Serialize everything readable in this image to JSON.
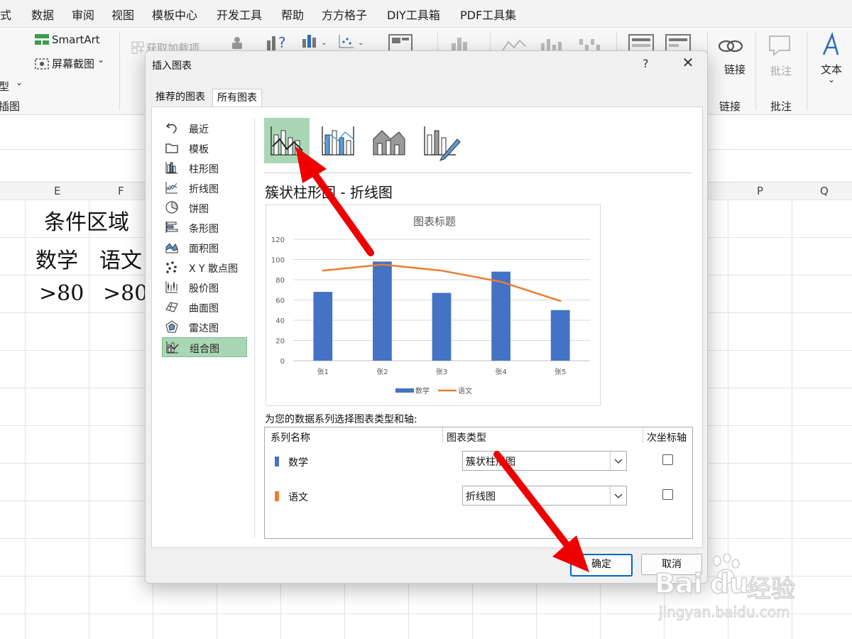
{
  "menu": {
    "items": [
      "公式",
      "数据",
      "审阅",
      "视图",
      "模板中心",
      "开发工具",
      "帮助",
      "方方格子",
      "DIY工具箱",
      "PDF工具集"
    ]
  },
  "ribbon": {
    "smartart": "SmartArt",
    "screenshot": "屏幕截图",
    "addins": "获取加载项",
    "group_illustrations": "插图",
    "shapes_partial": "型",
    "link": "链接",
    "link_btn": "链接",
    "comments_btn": "批注",
    "comments_group": "批注",
    "text_btn": "文本",
    "link_group": "链接"
  },
  "sheet": {
    "columns": [
      "E",
      "F",
      "P",
      "Q"
    ],
    "cells": {
      "condition_area": "条件区域",
      "math": "数学",
      "chinese": "语文",
      "val1": ">80",
      "val2": ">80"
    }
  },
  "dialog": {
    "title": "插入图表",
    "help": "?",
    "close": "✕",
    "tabs": {
      "recommended": "推荐的图表",
      "all": "所有图表"
    },
    "chart_types": [
      {
        "label": "最近",
        "icon": "undo-icon"
      },
      {
        "label": "模板",
        "icon": "folder-icon"
      },
      {
        "label": "柱形图",
        "icon": "column-chart-icon"
      },
      {
        "label": "折线图",
        "icon": "line-chart-icon"
      },
      {
        "label": "饼图",
        "icon": "pie-chart-icon"
      },
      {
        "label": "条形图",
        "icon": "bar-chart-icon"
      },
      {
        "label": "面积图",
        "icon": "area-chart-icon"
      },
      {
        "label": "X Y 散点图",
        "icon": "scatter-chart-icon"
      },
      {
        "label": "股价图",
        "icon": "stock-chart-icon"
      },
      {
        "label": "曲面图",
        "icon": "surface-chart-icon"
      },
      {
        "label": "雷达图",
        "icon": "radar-chart-icon"
      },
      {
        "label": "组合图",
        "icon": "combo-chart-icon"
      }
    ],
    "selected_type": "组合图",
    "subtype_title": "簇状柱形图 - 折线图",
    "series_prompt": "为您的数据系列选择图表类型和轴:",
    "table_headers": {
      "name": "系列名称",
      "type": "图表类型",
      "secondary": "次坐标轴"
    },
    "series_rows": [
      {
        "name": "数学",
        "type": "簇状柱形图",
        "color": "#4472c4",
        "secondary": false
      },
      {
        "name": "语文",
        "type": "折线图",
        "color": "#ed7d31",
        "secondary": false
      }
    ],
    "ok": "确定",
    "cancel": "取消"
  },
  "chart_data": {
    "type": "bar",
    "title": "图表标题",
    "categories": [
      "张1",
      "张2",
      "张3",
      "张4",
      "张5"
    ],
    "series": [
      {
        "name": "数学",
        "kind": "bar",
        "color": "#4472c4",
        "values": [
          68,
          98,
          67,
          88,
          50
        ]
      },
      {
        "name": "语文",
        "kind": "line",
        "color": "#ed7d31",
        "values": [
          89,
          95,
          89,
          78,
          59
        ]
      }
    ],
    "yticks": [
      0,
      20,
      40,
      60,
      80,
      100,
      120
    ],
    "ylim": [
      0,
      120
    ],
    "grid": true,
    "legend": "bottom"
  },
  "watermark": {
    "brand": "Bai",
    "brand2": "du",
    "cn": "经验",
    "url": "jingyan.baidu.com"
  },
  "colors": {
    "selection_green": "#a9d7b5",
    "arrow_red": "#ee0000",
    "ok_blue": "#0067c0"
  }
}
